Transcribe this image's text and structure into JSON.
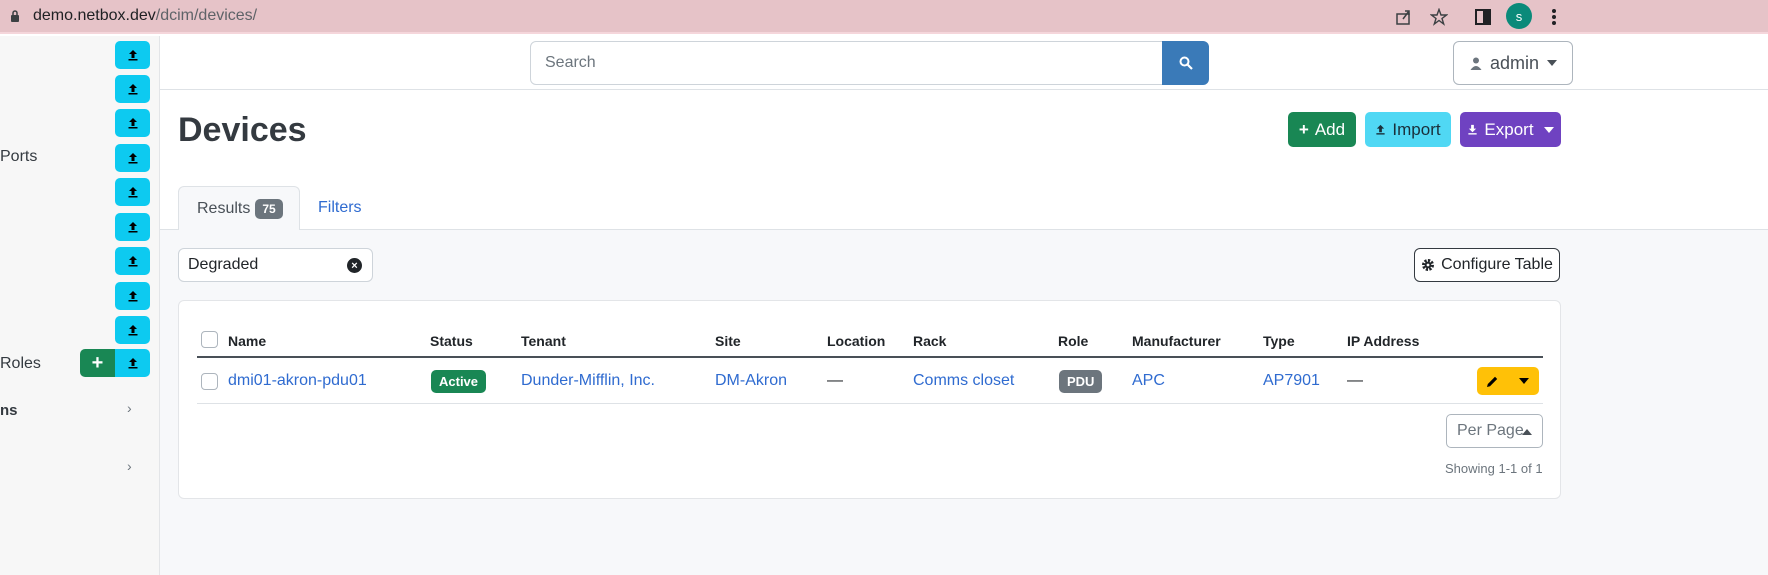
{
  "browser": {
    "url_host": "demo.netbox.dev",
    "url_path": "/dcim/devices/",
    "profile_initial": "s"
  },
  "sidebar": {
    "labels": [
      "Ports",
      "Roles"
    ],
    "section_partial": "ns"
  },
  "header": {
    "search_placeholder": "Search",
    "user": "admin"
  },
  "page": {
    "title": "Devices",
    "buttons": {
      "add": "Add",
      "import": "Import",
      "export": "Export"
    },
    "tabs": {
      "results": "Results",
      "results_count": "75",
      "filters": "Filters"
    },
    "filter_chip": "Degraded",
    "configure_table": "Configure Table"
  },
  "table": {
    "columns": [
      "Name",
      "Status",
      "Tenant",
      "Site",
      "Location",
      "Rack",
      "Role",
      "Manufacturer",
      "Type",
      "IP Address"
    ],
    "rows": [
      {
        "name": "dmi01-akron-pdu01",
        "status": "Active",
        "tenant": "Dunder-Mifflin, Inc.",
        "site": "DM-Akron",
        "location": "—",
        "rack": "Comms closet",
        "role": "PDU",
        "manufacturer": "APC",
        "type": "AP7901",
        "ip_address": "—"
      }
    ],
    "per_page": "Per Page",
    "showing": "Showing 1-1 of 1"
  },
  "colors": {
    "success": "#198754",
    "info": "#0dcaf0",
    "purple": "#6f42c1",
    "warning": "#ffc107",
    "link": "#2f6bd0"
  }
}
